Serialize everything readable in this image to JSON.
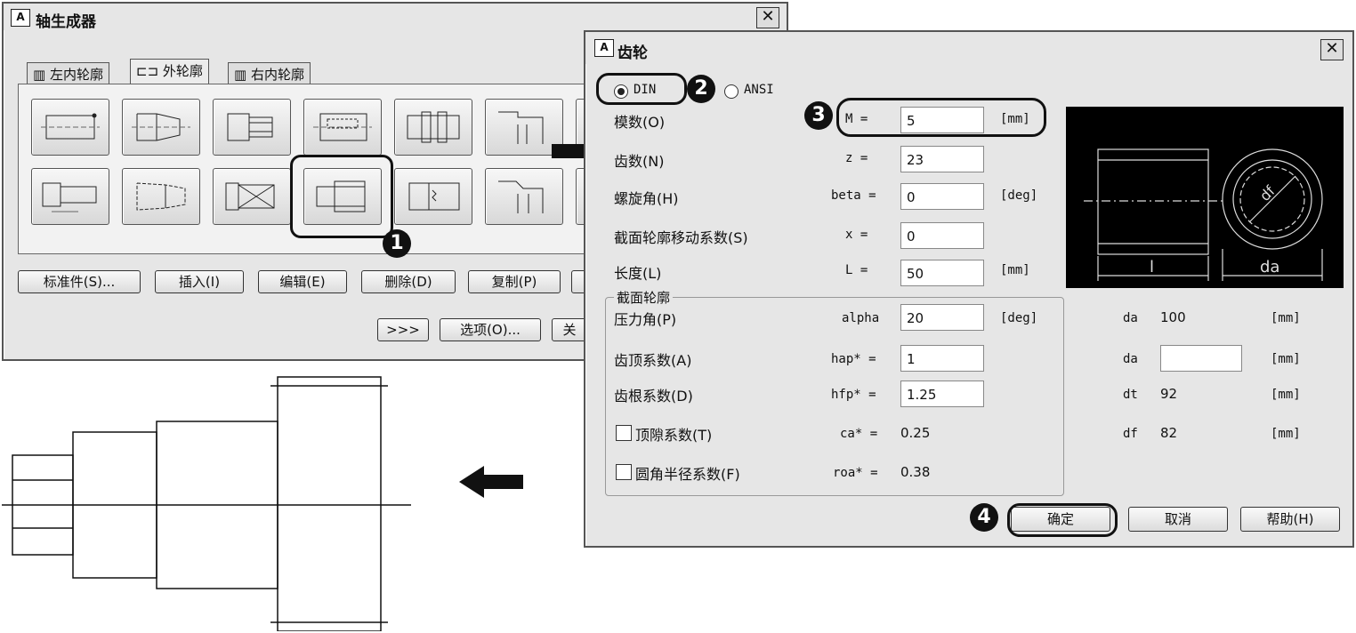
{
  "shaft_generator": {
    "title": "轴生成器",
    "app_icon_text": "A",
    "close_glyph": "✕",
    "tabs": [
      {
        "label": "左内轮廓",
        "icon": "left-inner-contour-icon"
      },
      {
        "label": "外轮廓",
        "icon": "outer-contour-icon"
      },
      {
        "label": "右内轮廓",
        "icon": "right-inner-contour-icon"
      }
    ],
    "buttons": {
      "standard": "标准件(S)...",
      "insert": "插入(I)",
      "edit": "编辑(E)",
      "delete": "删除(D)",
      "copy": "复制(P)",
      "expand": ">>>",
      "options": "选项(O)...",
      "close_partial": "关"
    }
  },
  "gear_dialog": {
    "title": "齿轮",
    "app_icon_text": "A",
    "close_glyph": "✕",
    "standard_options": [
      {
        "label": "DIN",
        "selected": true
      },
      {
        "label": "ANSI",
        "selected": false
      }
    ],
    "params": [
      {
        "label": "模数(O)",
        "symbol": "M =",
        "value": "5",
        "unit": "[mm]"
      },
      {
        "label": "齿数(N)",
        "symbol": "z =",
        "value": "23",
        "unit": ""
      },
      {
        "label": "螺旋角(H)",
        "symbol": "beta =",
        "value": "0",
        "unit": "[deg]"
      },
      {
        "label": "截面轮廓移动系数(S)",
        "symbol": "x =",
        "value": "0",
        "unit": ""
      },
      {
        "label": "长度(L)",
        "symbol": "L =",
        "value": "50",
        "unit": "[mm]"
      }
    ],
    "profile_group": {
      "title": "截面轮廓",
      "rows": [
        {
          "label": "压力角(P)",
          "symbol": "alpha",
          "value": "20",
          "unit": "[deg]"
        },
        {
          "label": "齿顶系数(A)",
          "symbol": "hap* =",
          "value": "1",
          "unit": ""
        },
        {
          "label": "齿根系数(D)",
          "symbol": "hfp* =",
          "value": "1.25",
          "unit": ""
        },
        {
          "label": "顶隙系数(T)",
          "symbol": "ca* =",
          "value": "0.25",
          "unit": ""
        },
        {
          "label": "圆角半径系数(F)",
          "symbol": "roa* =",
          "value": "0.38",
          "unit": ""
        }
      ]
    },
    "results": [
      {
        "symbol": "da",
        "value": "100",
        "unit": "[mm]"
      },
      {
        "symbol": "da",
        "value": "",
        "unit": "[mm]"
      },
      {
        "symbol": "dt",
        "value": "92",
        "unit": "[mm]"
      },
      {
        "symbol": "df",
        "value": "82",
        "unit": "[mm]"
      }
    ],
    "preview_labels": {
      "length": "l",
      "diameter_f": "df",
      "diameter_a": "da"
    },
    "buttons": {
      "ok": "确定",
      "cancel": "取消",
      "help": "帮助(H)"
    }
  },
  "callouts": [
    "1",
    "2",
    "3",
    "4"
  ],
  "colors": {
    "dialog_bg": "#e6e6e6",
    "preview_bg": "#000000",
    "callout": "#111111"
  }
}
